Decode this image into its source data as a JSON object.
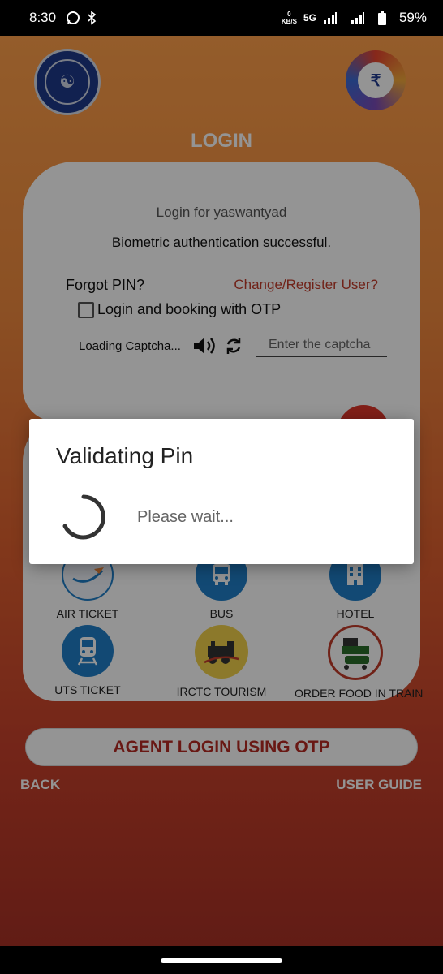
{
  "status_bar": {
    "time": "8:30",
    "net_speed_value": "0",
    "net_speed_unit": "KB/S",
    "network": "5G",
    "battery": "59%",
    "icons": [
      "whatsapp-icon",
      "bluetooth-icon",
      "signal-icon",
      "battery-icon"
    ]
  },
  "header": {
    "title": "LOGIN",
    "left_logo": "indian-railways-logo",
    "right_logo": "irctc-logo"
  },
  "login_card": {
    "login_for": "Login for yaswantyad",
    "biometric_message": "Biometric authentication successful.",
    "forgot_pin": "Forgot PIN?",
    "change_register": "Change/Register User?",
    "otp_checkbox_label": "Login and booking with OTP",
    "otp_checked": false,
    "captcha_loading": "Loading Captcha...",
    "captcha_placeholder": "Enter the captcha"
  },
  "services": [
    {
      "label": "AIR TICKET",
      "icon": "air-ticket-icon"
    },
    {
      "label": "BUS",
      "icon": "bus-icon"
    },
    {
      "label": "HOTEL",
      "icon": "hotel-icon"
    },
    {
      "label": "UTS TICKET",
      "icon": "train-icon"
    },
    {
      "label": "IRCTC TOURISM",
      "icon": "tourism-icon"
    },
    {
      "label": "ORDER FOOD IN TRAIN",
      "icon": "food-track-icon"
    }
  ],
  "footer": {
    "agent_button": "AGENT LOGIN USING OTP",
    "back": "BACK",
    "user_guide": "USER GUIDE"
  },
  "dialog": {
    "title": "Validating Pin",
    "message": "Please wait..."
  },
  "colors": {
    "accent_red": "#c23b2a",
    "service_blue": "#1f7fc8",
    "dialog_bg": "#ffffff"
  }
}
